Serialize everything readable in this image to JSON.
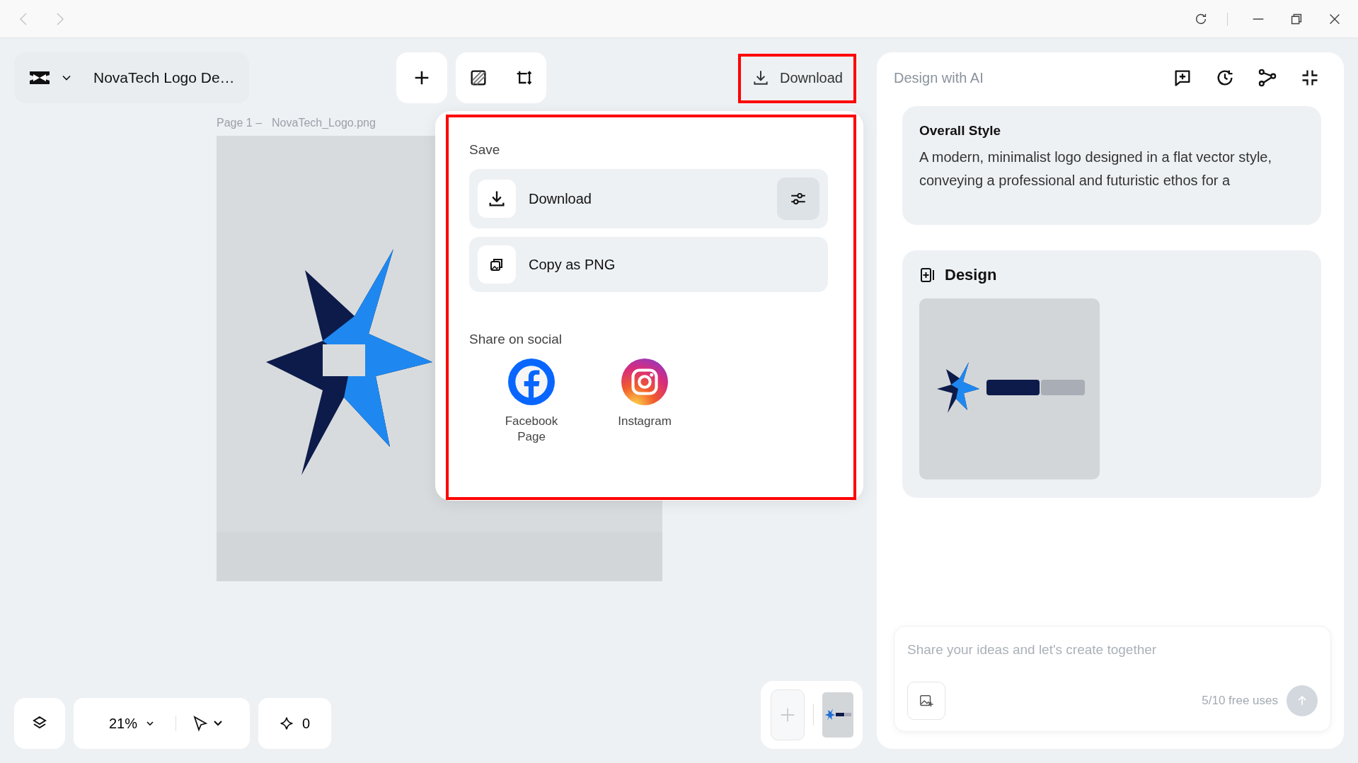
{
  "project": {
    "title": "NovaTech Logo De…"
  },
  "toolbar": {
    "download_label": "Download"
  },
  "canvas": {
    "page_label": "Page 1 –",
    "file_name": "NovaTech_Logo.png"
  },
  "export_menu": {
    "save_heading": "Save",
    "save_actions": [
      {
        "kind": "download",
        "label": "Download"
      },
      {
        "kind": "copy",
        "label": "Copy as PNG"
      }
    ],
    "share_heading": "Share on social",
    "share_targets": [
      {
        "kind": "facebook",
        "label": "Facebook Page"
      },
      {
        "kind": "instagram",
        "label": "Instagram"
      }
    ]
  },
  "ai_panel": {
    "title": "Design with AI",
    "style_card": {
      "heading": "Overall Style",
      "text": "A modern, minimalist logo designed in a flat vector style, conveying a professional and futuristic ethos for a"
    },
    "design_card": {
      "heading": "Design"
    },
    "prompt": {
      "placeholder": "Share your ideas and let's create together",
      "usage": "5/10 free uses"
    }
  },
  "bottom_bar": {
    "zoom": "21%",
    "credits": "0"
  }
}
